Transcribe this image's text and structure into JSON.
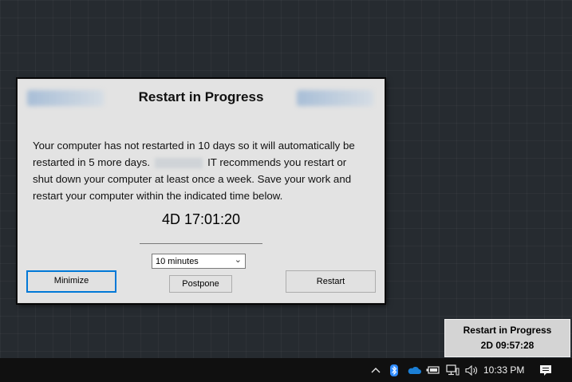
{
  "dialog": {
    "title": "Restart in Progress",
    "message_part1": "Your computer has not restarted in 10 days so it will automatically be restarted in 5 more days.",
    "message_part2": "IT recommends you restart or shut down your computer at least once a week. Save your work and restart your computer within the indicated time below.",
    "countdown": "4D 17:01:20",
    "postpone_select": {
      "selected": "10 minutes"
    },
    "buttons": {
      "minimize": "Minimize",
      "postpone": "Postpone",
      "restart": "Restart"
    }
  },
  "toast": {
    "title": "Restart in Progress",
    "countdown": "2D 09:57:28"
  },
  "taskbar": {
    "time": "10:33 PM",
    "tray_icons": [
      "chevron-up-icon",
      "bluetooth-icon",
      "onedrive-cloud-icon",
      "battery-icon",
      "network-icon",
      "volume-icon",
      "notification-icon"
    ]
  },
  "colors": {
    "dialog_bg": "#e3e3e3",
    "focus_accent": "#0078d7",
    "bluetooth": "#2f8bff",
    "onedrive": "#1b7fd6",
    "taskbar": "#101010"
  }
}
